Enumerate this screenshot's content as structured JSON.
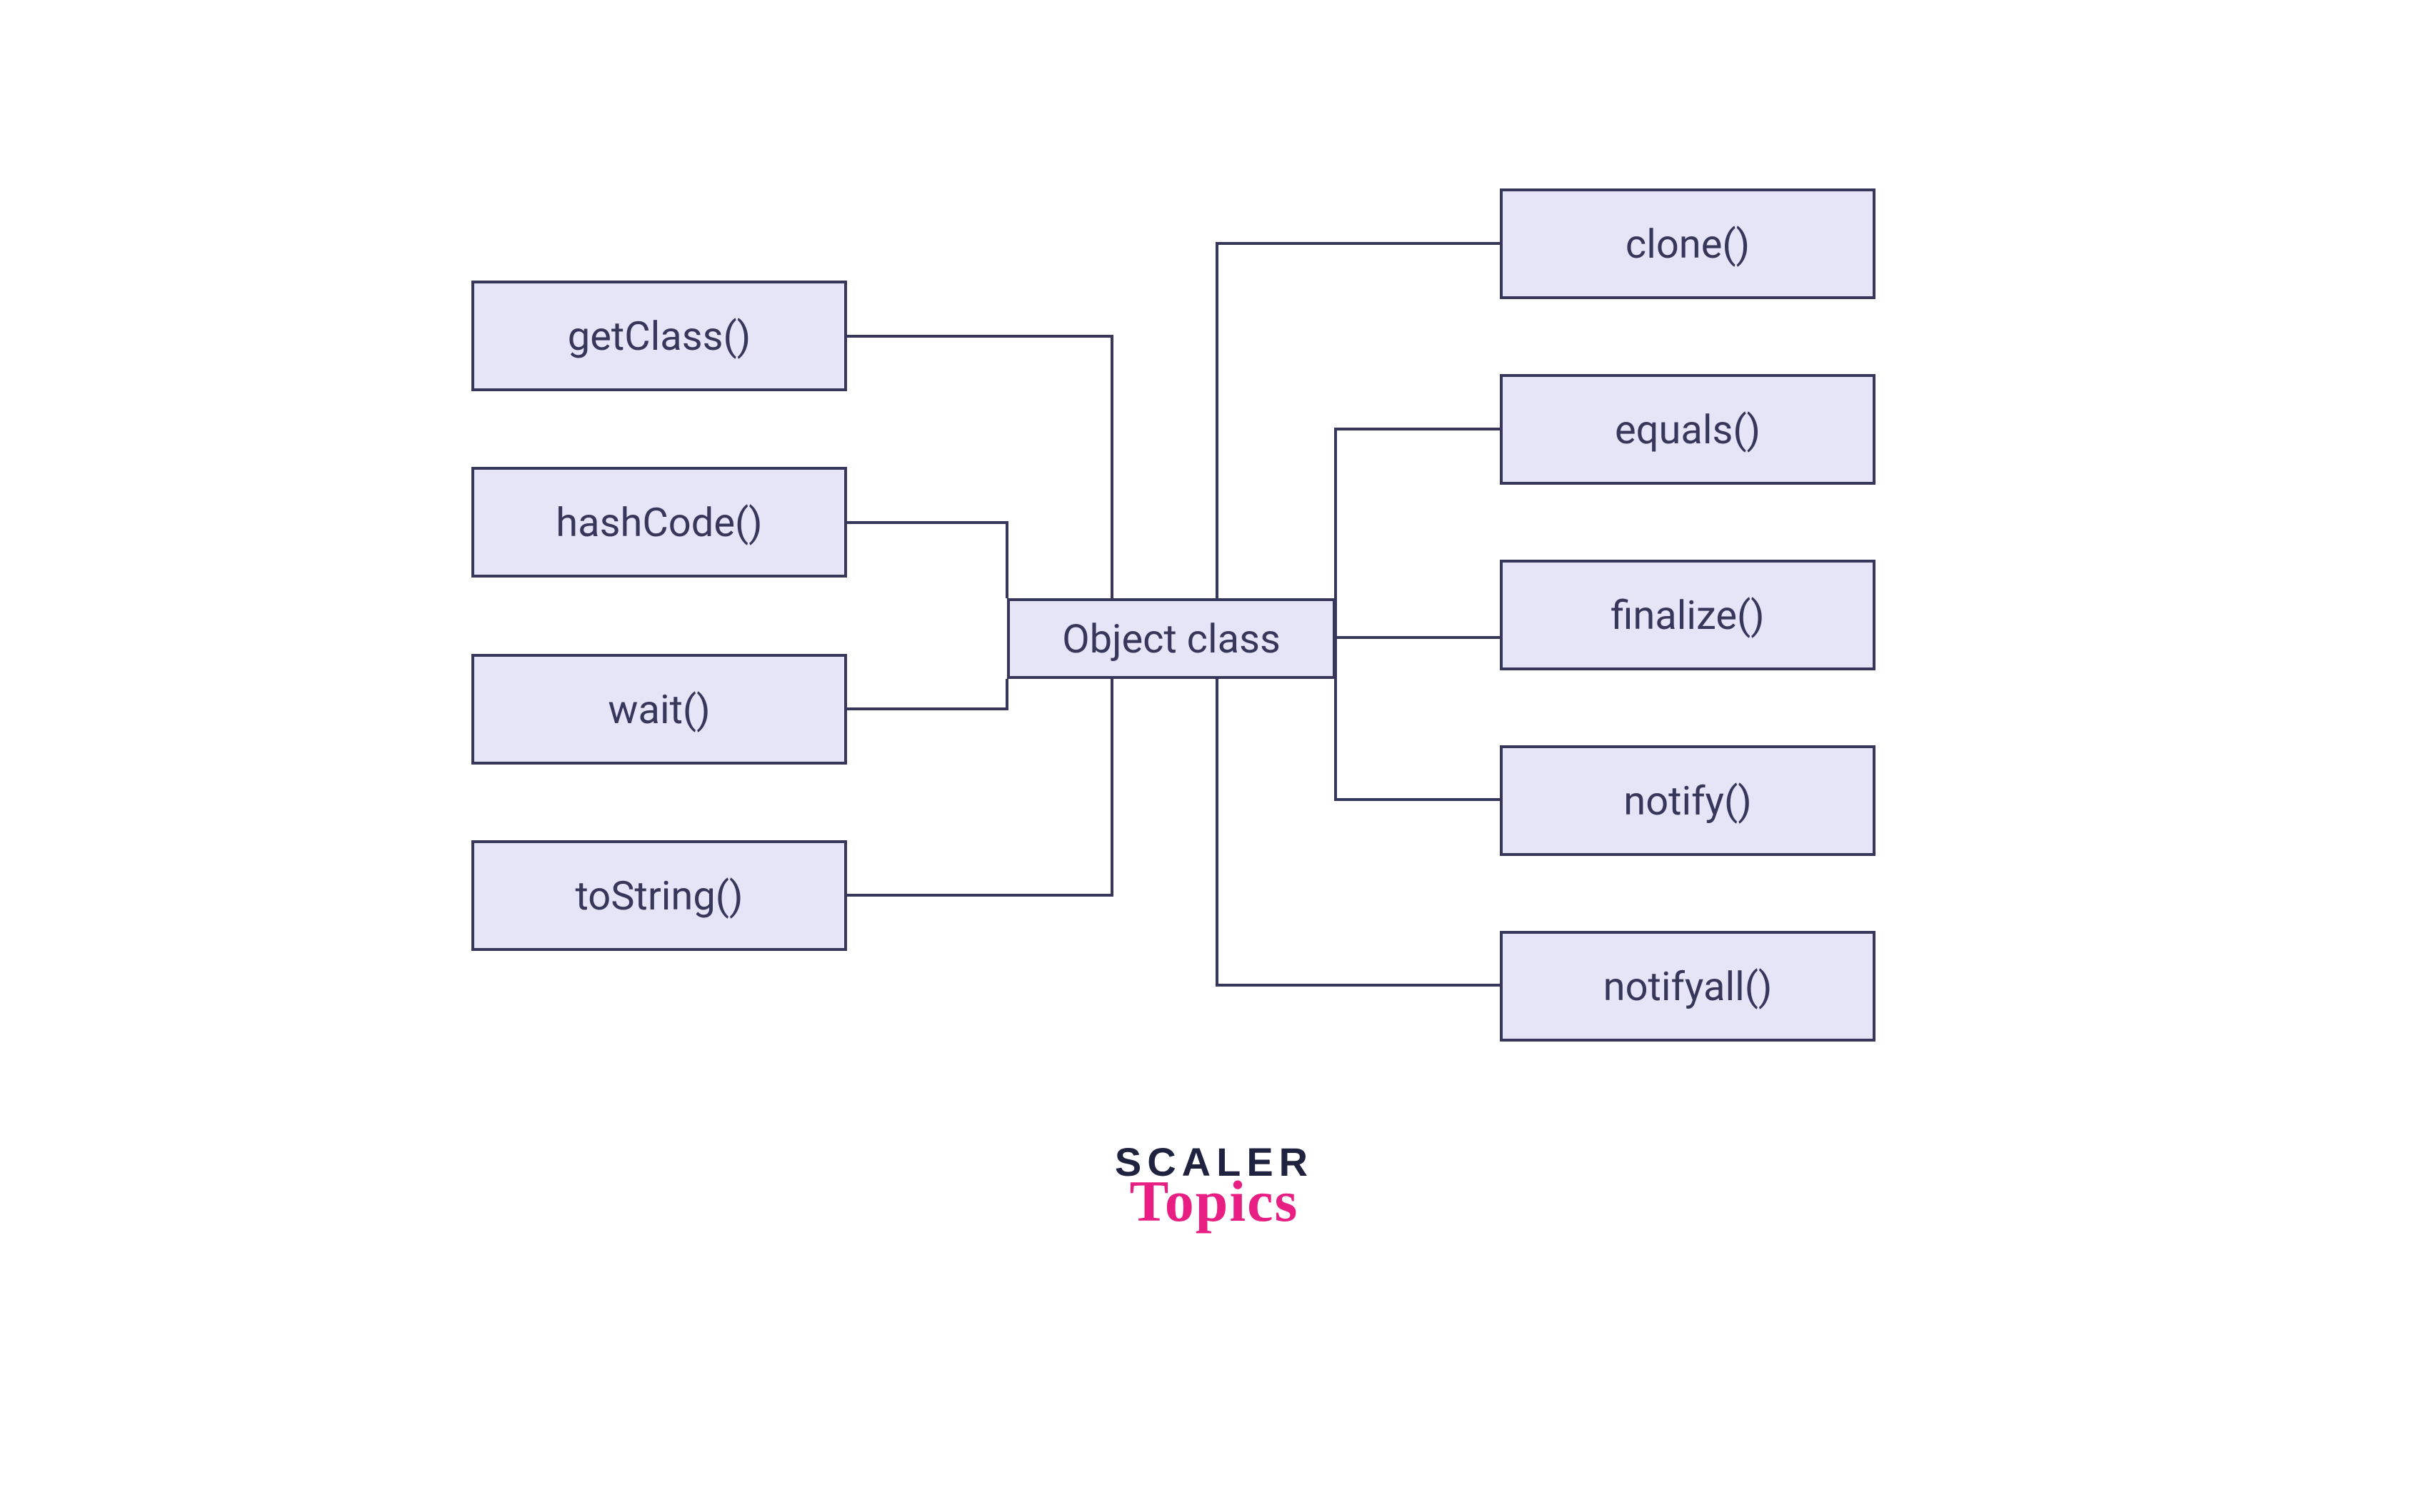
{
  "diagram": {
    "center": {
      "label": "Object class"
    },
    "left_nodes": [
      {
        "label": "getClass()"
      },
      {
        "label": "hashCode()"
      },
      {
        "label": "wait()"
      },
      {
        "label": "toString()"
      }
    ],
    "right_nodes": [
      {
        "label": "clone()"
      },
      {
        "label": "equals()"
      },
      {
        "label": "finalize()"
      },
      {
        "label": "notify()"
      },
      {
        "label": "notifyall()"
      }
    ]
  },
  "branding": {
    "scaler": "SCALER",
    "topics": "Topics"
  },
  "colors": {
    "node_fill": "#e5e5f7",
    "node_border": "#37375c",
    "text": "#37375c",
    "accent": "#e91e82",
    "brand_dark": "#1f2340"
  }
}
